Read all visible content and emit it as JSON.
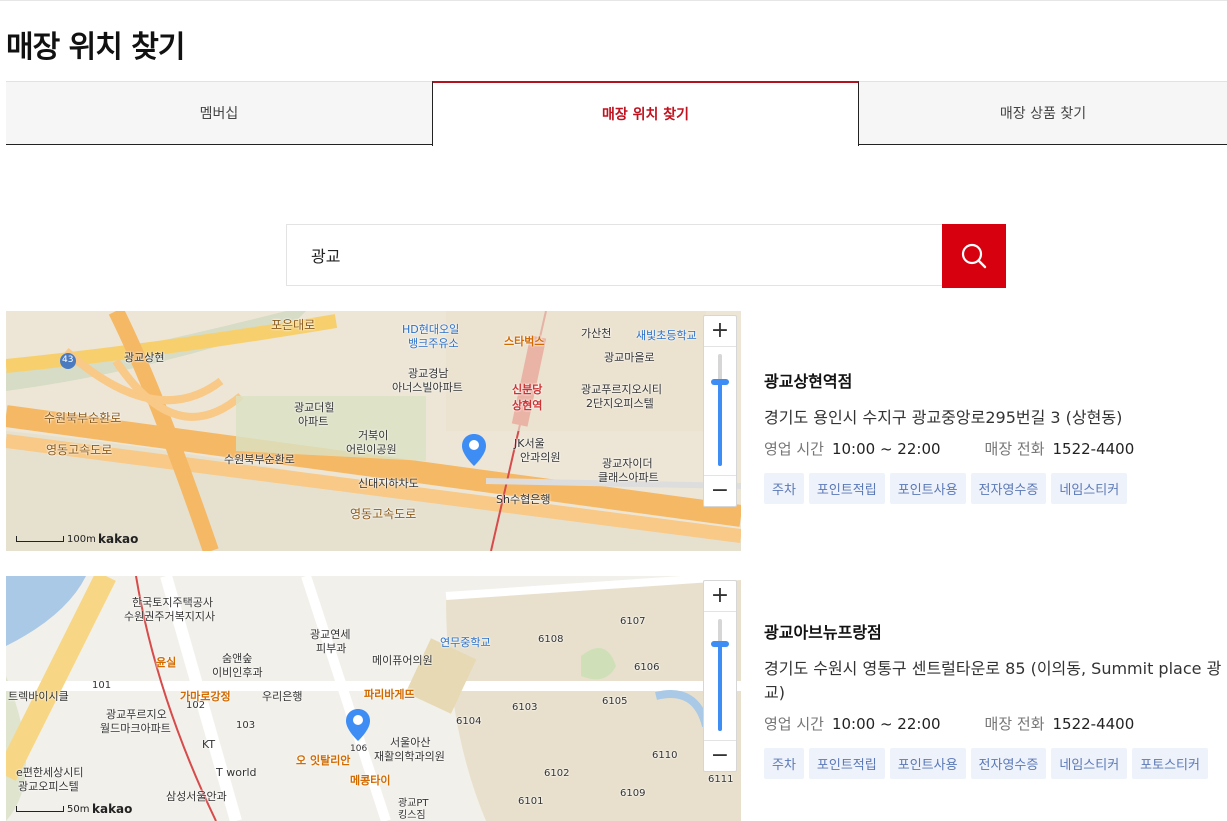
{
  "page": {
    "title": "매장 위치 찾기"
  },
  "tabs": [
    {
      "label": "멤버십"
    },
    {
      "label": "매장 위치 찾기"
    },
    {
      "label": "매장 상품 찾기"
    }
  ],
  "search": {
    "value": "광교"
  },
  "map_common": {
    "attribution": "kakao",
    "zoom_in": "+",
    "zoom_out": "−"
  },
  "stores": [
    {
      "name": "광교상현역점",
      "address": "경기도 용인시 수지구 광교중앙로295번길 3 (상현동)",
      "hours_label": "영업 시간",
      "hours": "10:00 ~ 22:00",
      "phone_label": "매장 전화",
      "phone": "1522-4400",
      "tags": [
        "주차",
        "포인트적립",
        "포인트사용",
        "전자영수증",
        "네임스티커"
      ],
      "map": {
        "scale": "100m",
        "zoom_level": 0.75,
        "labels": [
          "포은대로",
          "HD현대오일",
          "뱅크주유소",
          "스타벅스",
          "가산천",
          "새빛초등학교",
          "광교상현",
          "광교경남",
          "아너스빌아파트",
          "신분당",
          "상현역",
          "광교마을로",
          "광교푸르지오시티",
          "2단지오피스텔",
          "수원북부순환로",
          "광교더힐",
          "아파트",
          "거북이",
          "어린이공원",
          "영동고속도로",
          "JK서울",
          "안과의원",
          "광교자이더",
          "클래스아파트",
          "수원북부순환로",
          "신대지하차도",
          "Sh수협은행",
          "영동고속도로",
          "43"
        ]
      }
    },
    {
      "name": "광교아브뉴프랑점",
      "address": "경기도 수원시 영통구 센트럴타운로 85 (이의동, Summit place 광교)",
      "hours_label": "영업 시간",
      "hours": "10:00 ~ 22:00",
      "phone_label": "매장 전화",
      "phone": "1522-4400",
      "tags": [
        "주차",
        "포인트적립",
        "포인트사용",
        "전자영수증",
        "네임스티커",
        "포토스티커"
      ],
      "map": {
        "scale": "50m",
        "zoom_level": 0.78,
        "labels": [
          "한국토지주택공사",
          "수원권주거복지지사",
          "광교연세",
          "피부과",
          "연무중학교",
          "6108",
          "6107",
          "윤실",
          "숨앤숲",
          "이비인후과",
          "메이퓨어의원",
          "6106",
          "트렉바이시클",
          "101",
          "102",
          "가마로강정",
          "우리은행",
          "파리바게뜨",
          "6105",
          "광교푸르지오",
          "월드마크아파트",
          "103",
          "6104",
          "6103",
          "KT",
          "106",
          "서울아산",
          "재활의학과의원",
          "6110",
          "e편한세상시티",
          "광교오피스텔",
          "T world",
          "오 잇탈리안",
          "메콩타이",
          "6102",
          "6109",
          "6111",
          "삼성서울안과",
          "광교PT",
          "킹스짐",
          "6101"
        ]
      }
    }
  ]
}
